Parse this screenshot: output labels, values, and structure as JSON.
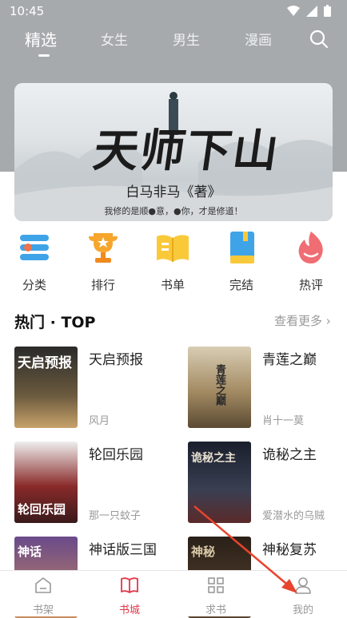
{
  "status_bar": {
    "time": "10:45"
  },
  "tabs": [
    {
      "label": "精选"
    },
    {
      "label": "女生"
    },
    {
      "label": "男生"
    },
    {
      "label": "漫画"
    }
  ],
  "banner": {
    "title": "天师下山",
    "author": "白马非马《著》",
    "tagline": "我修的是顺●意，●你，才是修道！"
  },
  "categories": [
    {
      "label": "分类",
      "icon": "list-icon"
    },
    {
      "label": "排行",
      "icon": "trophy-icon"
    },
    {
      "label": "书单",
      "icon": "book-list-icon"
    },
    {
      "label": "完结",
      "icon": "finished-book-icon"
    },
    {
      "label": "热评",
      "icon": "flame-icon"
    }
  ],
  "section": {
    "title": "热门 · TOP",
    "more": "查看更多"
  },
  "books": [
    {
      "title": "天启预报",
      "author": "风月",
      "cover_text": "天启预报"
    },
    {
      "title": "青莲之巅",
      "author": "肖十一莫",
      "cover_text": "青莲之巅"
    },
    {
      "title": "轮回乐园",
      "author": "那一只蚊子",
      "cover_text": "轮回乐园"
    },
    {
      "title": "诡秘之主",
      "author": "爱潜水的乌贼",
      "cover_text": "诡秘之主"
    },
    {
      "title": "神话版三国",
      "author": "",
      "cover_text": "神话"
    },
    {
      "title": "神秘复苏",
      "author": "",
      "cover_text": "神秘"
    }
  ],
  "bottom_nav": [
    {
      "label": "书架",
      "icon": "bookshelf-icon",
      "active": false
    },
    {
      "label": "书城",
      "icon": "bookstore-icon",
      "active": true
    },
    {
      "label": "求书",
      "icon": "grid-icon",
      "active": false
    },
    {
      "label": "我的",
      "icon": "profile-icon",
      "active": false
    }
  ],
  "colors": {
    "accent": "#e2364a",
    "header_bg": "#a7aaad",
    "annotation_arrow": "#e8442e"
  }
}
